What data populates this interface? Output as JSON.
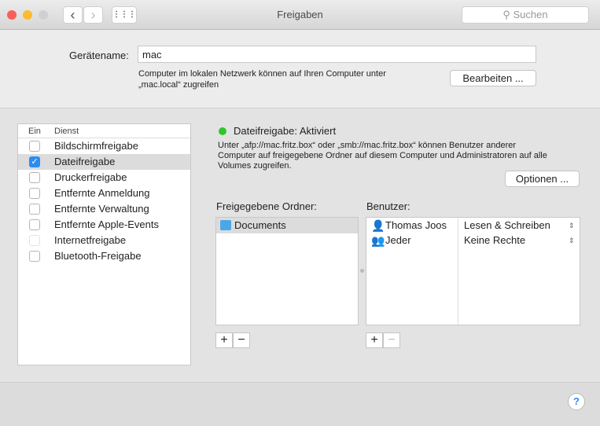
{
  "window": {
    "title": "Freigaben",
    "search_placeholder": "Suchen",
    "back": "‹",
    "forward": "›",
    "grid": "⋮⋮⋮"
  },
  "device": {
    "label": "Gerätename:",
    "value": "mac",
    "info_line1": "Computer im lokalen Netzwerk können auf Ihren Computer unter",
    "info_line2": "„mac.local“ zugreifen",
    "edit_button": "Bearbeiten ..."
  },
  "services": {
    "col_on": "Ein",
    "col_service": "Dienst",
    "items": [
      {
        "label": "Bildschirmfreigabe",
        "checked": false
      },
      {
        "label": "Dateifreigabe",
        "checked": true
      },
      {
        "label": "Druckerfreigabe",
        "checked": false
      },
      {
        "label": "Entfernte Anmeldung",
        "checked": false
      },
      {
        "label": "Entfernte Verwaltung",
        "checked": false
      },
      {
        "label": "Entfernte Apple-Events",
        "checked": false
      },
      {
        "label": "Internetfreigabe",
        "checked": false
      },
      {
        "label": "Bluetooth-Freigabe",
        "checked": false
      }
    ]
  },
  "status": {
    "title": "Dateifreigabe: Aktiviert",
    "color": "#2ec52e",
    "desc_line1": "Unter „afp://mac.fritz.box“ oder „smb://mac.fritz.box“ können Benutzer anderer",
    "desc_line2": "Computer auf freigegebene Ordner auf diesem Computer und Administratoren auf alle",
    "desc_line3": "Volumes zugreifen.",
    "options_button": "Optionen ..."
  },
  "folders": {
    "label": "Freigegebene Ordner:",
    "items": [
      "Documents"
    ]
  },
  "users": {
    "label": "Benutzer:",
    "items": [
      {
        "name": "Thomas Joos",
        "perm": "Lesen & Schreiben"
      },
      {
        "name": "Jeder",
        "perm": "Keine Rechte"
      }
    ]
  },
  "controls": {
    "add": "+",
    "remove": "−",
    "help": "?"
  }
}
